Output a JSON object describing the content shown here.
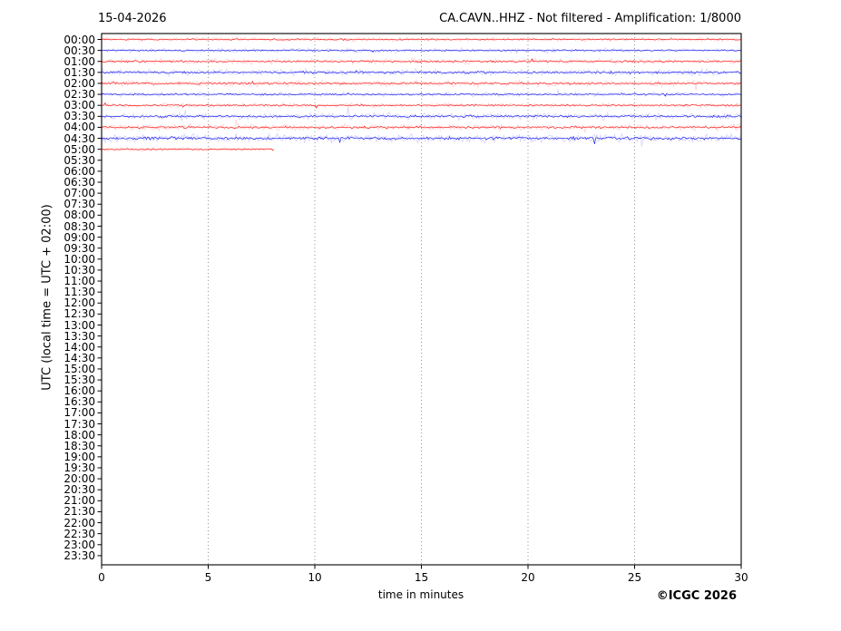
{
  "chart_data": {
    "type": "line",
    "subtype": "helicorder-seismogram",
    "title_left": "15-04-2026",
    "title_right": "CA.CAVN..HHZ - Not filtered - Amplification: 1/8000",
    "xlabel": "time in minutes",
    "ylabel": "UTC (local time = UTC + 02:00)",
    "x_range": [
      0,
      30
    ],
    "x_ticks": [
      "0",
      "5",
      "10",
      "15",
      "20",
      "25",
      "30"
    ],
    "grid": {
      "vertical_gridlines_at_minutes": [
        5,
        10,
        15,
        20,
        25
      ],
      "style": "dotted",
      "color": "#8a8a8a"
    },
    "y_tick_labels": [
      "00:00",
      "00:30",
      "01:00",
      "01:30",
      "02:00",
      "02:30",
      "03:00",
      "03:30",
      "04:00",
      "04:30",
      "05:00",
      "05:30",
      "06:00",
      "06:30",
      "07:00",
      "07:30",
      "08:00",
      "08:30",
      "09:00",
      "09:30",
      "10:00",
      "10:30",
      "11:00",
      "11:30",
      "12:00",
      "12:30",
      "13:00",
      "13:30",
      "14:00",
      "14:30",
      "15:00",
      "15:30",
      "16:00",
      "16:30",
      "17:00",
      "17:30",
      "18:00",
      "18:30",
      "19:00",
      "19:30",
      "20:00",
      "20:30",
      "21:00",
      "21:30",
      "22:00",
      "22:30",
      "23:00",
      "23:30"
    ],
    "colors": {
      "red": "#ff0000",
      "blue": "#0000ee",
      "axis": "#000000"
    },
    "traces": [
      {
        "utc": "00:00",
        "color": "red",
        "start_min": 0,
        "end_min": 30,
        "amplitude": 1.0
      },
      {
        "utc": "00:30",
        "color": "blue",
        "start_min": 0,
        "end_min": 30,
        "amplitude": 1.0
      },
      {
        "utc": "01:00",
        "color": "red",
        "start_min": 0,
        "end_min": 30,
        "amplitude": 1.3
      },
      {
        "utc": "01:30",
        "color": "blue",
        "start_min": 0,
        "end_min": 30,
        "amplitude": 1.5
      },
      {
        "utc": "02:00",
        "color": "red",
        "start_min": 0,
        "end_min": 30,
        "amplitude": 1.4
      },
      {
        "utc": "02:30",
        "color": "blue",
        "start_min": 0,
        "end_min": 30,
        "amplitude": 1.0
      },
      {
        "utc": "03:00",
        "color": "red",
        "start_min": 0,
        "end_min": 30,
        "amplitude": 1.1
      },
      {
        "utc": "03:30",
        "color": "blue",
        "start_min": 0,
        "end_min": 30,
        "amplitude": 1.5
      },
      {
        "utc": "04:00",
        "color": "red",
        "start_min": 0,
        "end_min": 30,
        "amplitude": 1.5
      },
      {
        "utc": "04:30",
        "color": "blue",
        "start_min": 0,
        "end_min": 30,
        "amplitude": 1.9
      },
      {
        "utc": "05:00",
        "color": "red",
        "start_min": 0,
        "end_min": 8.1,
        "amplitude": 1.0
      }
    ],
    "rows_without_signal": "05:30 through 23:30"
  },
  "footer": {
    "credit": "©ICGC 2026"
  }
}
